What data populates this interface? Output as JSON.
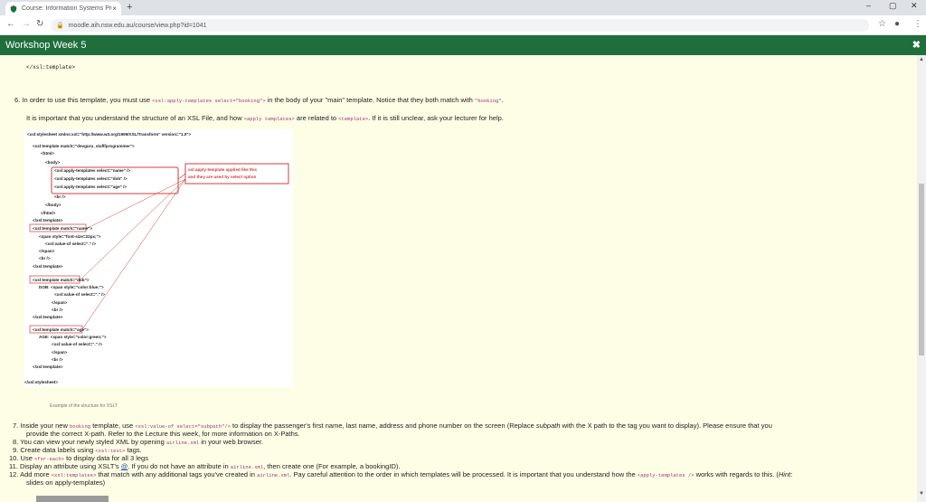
{
  "browser": {
    "tab_title": "Course: Information Systems Pro",
    "tab_close": "×",
    "new_tab": "+",
    "url": "moodle.aih.nsw.edu.au/course/view.php?id=1041",
    "win_min": "–",
    "win_max": "▢",
    "win_close": "✕"
  },
  "modal": {
    "title": "Workshop Week 5",
    "close": "✖"
  },
  "content": {
    "top_code": "</xsl:template>",
    "step6": {
      "num": "6.",
      "t1": "In order to use this template, you must use",
      "c1": "<xsl:apply-templates select=\"booking\">",
      "t2": "in the body of your \"main\" template. Notice that they both match with",
      "c2": "\"booking\"",
      "t3": "."
    },
    "important": {
      "t1": "It is important that you understand the structure of an XSL File, and how",
      "c1": "<apply templates>",
      "t2": "are related to",
      "c2": "<template>",
      "t3": ". If it is still unclear, ask your lecturer for help."
    },
    "figure": {
      "lines": [
        "<xsl:stylesheet xmlns:xsl=\"http://www.w3.org/1999/XSL/Transform\" version=\"1.0\">",
        "<xsl:template match=\"devguru_staff/programmer\">",
        "<html>",
        "<body>",
        "<xsl:apply-templates select=\"name\" />",
        "<xsl:apply-templates select=\"dob\" />",
        "<xsl:apply-templates select=\"age\" />",
        "<br />",
        "</body>",
        "</html>",
        "</xsl:template>",
        "<xsl:template match=\"name\">",
        "<span style=\"font-size=22px;\">",
        "<xsl:value-of select=\".\" />",
        "</span>",
        "<br />",
        "</xsl:template>",
        "<xsl:template match=\"dob\">",
        "DOB: <span style=\"color:blue;\">",
        "<xsl:value-of select=\".\" />",
        "</span>",
        "<br />",
        "</xsl:template>",
        "<xsl:template match=\"age\">",
        "AGE: <span style=\"color:green;\">",
        "<xsl:value-of select=\".\" />",
        "</span>",
        "<br />",
        "</xsl:template>",
        "</xsl:stylesheet>"
      ],
      "callout_l1": "xsl:apply-template applied like this",
      "callout_l2": "and they are used by select option"
    },
    "caption": "Example of the structure for XSLT",
    "step7": {
      "num": "7.",
      "t1": "Inside your new",
      "c1": "booking",
      "t2": "template, use",
      "c2": "<xsl:value-of select=\"subpath\"/>",
      "t3": "to display the passenger's first name, last name, address and phone number on the screen (Replace",
      "em": "subpath",
      "t4": "with the X path to the tag you want to display). Please ensure that you",
      "line2": "provide the correct X-path. Refer to the Lecture this week, for more information on X-Paths."
    },
    "step8": {
      "num": "8.",
      "t1": "You can view your newly styled XML by opening",
      "c1": "airline.xml",
      "t2": "in your web browser."
    },
    "step9": {
      "num": "9.",
      "t1": "Create data labels using",
      "c1": "<xsl:text>",
      "t2": "tags."
    },
    "step10": {
      "num": "10.",
      "t1": "Use",
      "c1": "<for-each>",
      "t2": "to display data for all 3 legs"
    },
    "step11": {
      "num": "11.",
      "t1": "Display an attribute using XSLT's",
      "link": "@",
      "t2": ". If you do not have an attribute in",
      "c1": "airline.xml",
      "t3": ", then create one (For example, a bookingID)."
    },
    "step12": {
      "num": "12.",
      "t1": "Add more",
      "c1": "<xsl:templates>",
      "t2": "that match with any additional tags you've created in",
      "c2": "airline.xml",
      "t3": ". Pay careful attention to the order in which templates will be processed. It is important that you understand how the",
      "c3": "<apply-templates />",
      "t4": "works with regards to this. (",
      "em": "Hint",
      "t5": ":",
      "line2": "slides on apply-templates)"
    }
  }
}
